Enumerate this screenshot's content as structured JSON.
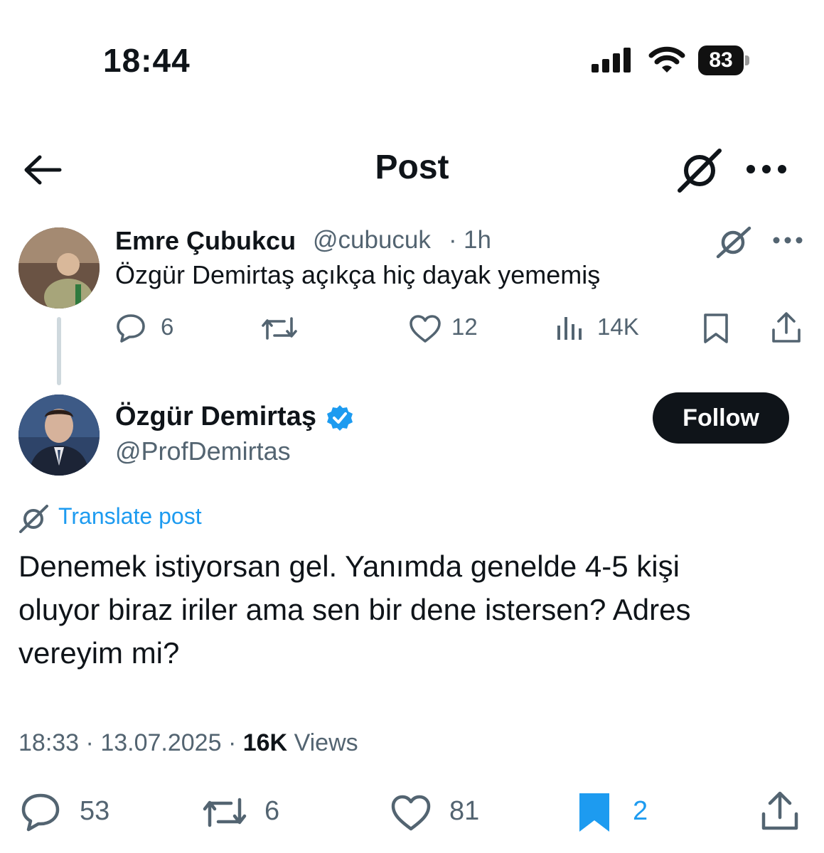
{
  "status_bar": {
    "time": "18:44",
    "battery": "83",
    "icons": [
      "cellular-signal-icon",
      "wifi-icon",
      "battery-icon"
    ]
  },
  "header": {
    "title": "Post",
    "icons": [
      "back-arrow-icon",
      "grok-icon",
      "more-icon"
    ]
  },
  "parent_tweet": {
    "name": "Emre Çubukcu",
    "handle": "@cubucuk",
    "separator": "·",
    "time": "1h",
    "text": "Özgür Demirtaş açıkça hiç dayak yememiş",
    "replies": "6",
    "likes": "12",
    "views": "14K"
  },
  "main_tweet": {
    "name": "Özgür Demirtaş",
    "handle": "@ProfDemirtas",
    "follow_label": "Follow",
    "translate_label": "Translate post",
    "text_lines": [
      "Denemek istiyorsan gel. Yanımda genelde 4-5 kişi",
      "oluyor biraz iriler ama sen bir dene istersen? Adres",
      "vereyim mi?"
    ],
    "meta": {
      "time": "18:33",
      "date": "13.07.2025",
      "separator": "·",
      "views_count": "16K",
      "views_label": "Views"
    },
    "actions": {
      "replies": "53",
      "reposts": "6",
      "likes": "81",
      "bookmarks": "2"
    }
  },
  "colors": {
    "text": "#0f1419",
    "secondary": "#536471",
    "accent": "#1d9bf0",
    "follow_bg": "#0f1419"
  }
}
